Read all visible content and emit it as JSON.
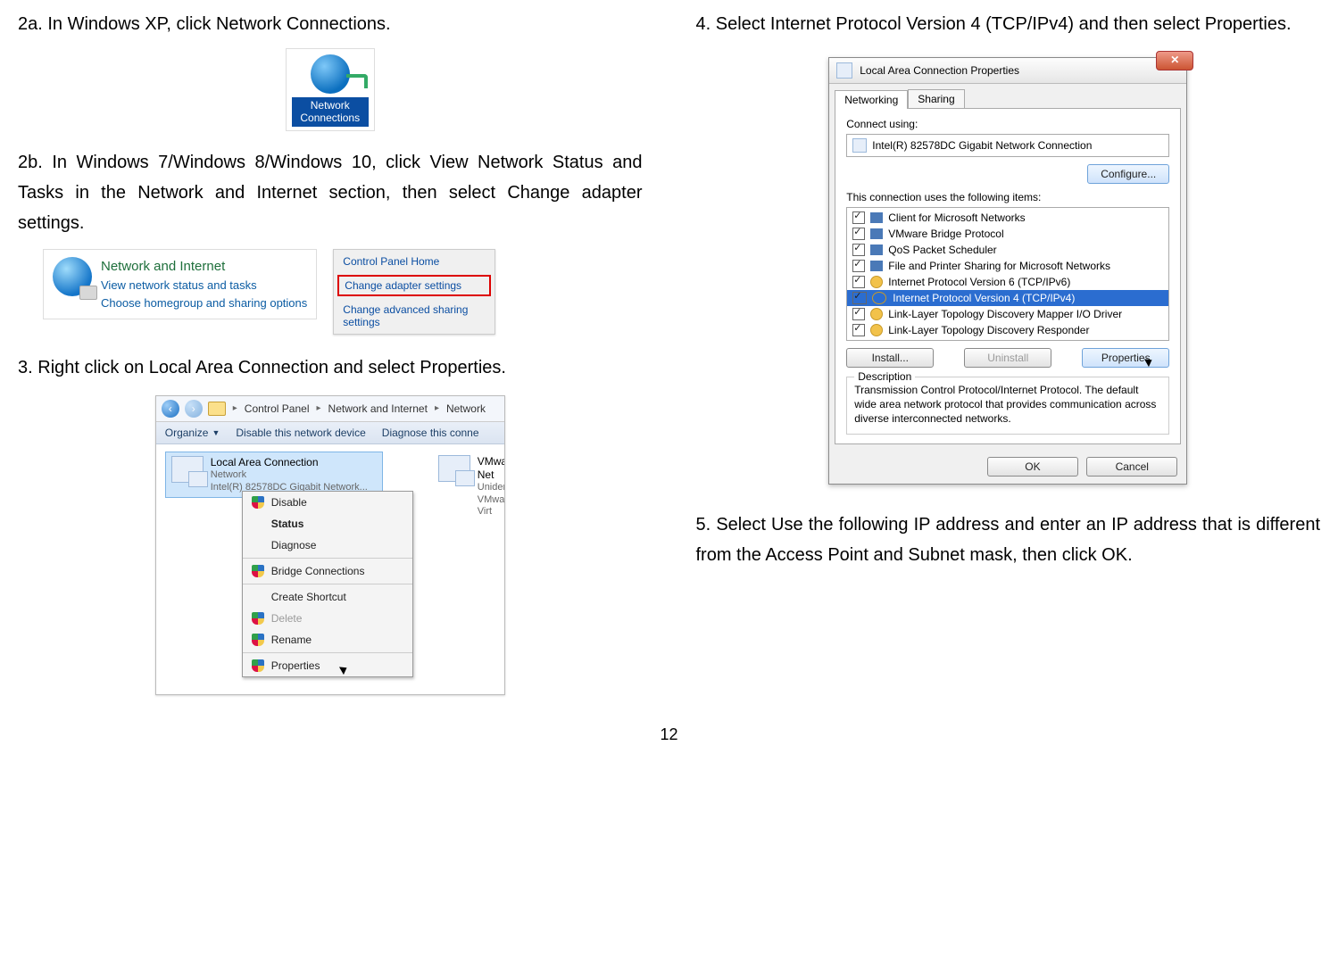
{
  "page_number": "12",
  "left": {
    "step2a": {
      "num": "2a.",
      "text": "In Windows XP, click Network Connections."
    },
    "xp_icon_label": "Network Connections",
    "step2b": {
      "num": "2b.",
      "text": "In Windows 7/Windows 8/Windows 10, click View Network Status and Tasks in the Network and Internet section, then select Change adapter settings."
    },
    "ni_title": "Network and Internet",
    "ni_links": [
      "View network status and tasks",
      "Choose homegroup and sharing options"
    ],
    "cph": {
      "title": "Control Panel Home",
      "items": [
        "Change adapter settings",
        "Change advanced sharing settings"
      ]
    },
    "step3": {
      "num": "3.",
      "text": "Right click on Local Area Connection and select Properties."
    },
    "fig3": {
      "breadcrumb": [
        "Control Panel",
        "Network and Internet",
        "Network"
      ],
      "toolbar": [
        "Organize",
        "Disable this network device",
        "Diagnose this conne"
      ],
      "lac": {
        "name": "Local Area Connection",
        "net": "Network",
        "adapter": "Intel(R) 82578DC Gigabit Network..."
      },
      "vm": {
        "name": "VMware Net",
        "net": "Unidentified",
        "adapter": "VMware Virt"
      },
      "ctx": [
        "Disable",
        "Status",
        "Diagnose",
        "Bridge Connections",
        "Create Shortcut",
        "Delete",
        "Rename",
        "Properties"
      ]
    }
  },
  "right": {
    "step4": {
      "num": "4.",
      "text": "Select Internet Protocol Version 4 (TCP/IPv4) and then select Properties."
    },
    "fig4": {
      "title": "Local Area Connection Properties",
      "close": "✕",
      "tabs": [
        "Networking",
        "Sharing"
      ],
      "connect_using_label": "Connect using:",
      "adapter": "Intel(R) 82578DC Gigabit Network Connection",
      "configure": "Configure...",
      "items_label": "This connection uses the following items:",
      "items": [
        "Client for Microsoft Networks",
        "VMware Bridge Protocol",
        "QoS Packet Scheduler",
        "File and Printer Sharing for Microsoft Networks",
        "Internet Protocol Version 6 (TCP/IPv6)",
        "Internet Protocol Version 4 (TCP/IPv4)",
        "Link-Layer Topology Discovery Mapper I/O Driver",
        "Link-Layer Topology Discovery Responder"
      ],
      "buttons": [
        "Install...",
        "Uninstall",
        "Properties"
      ],
      "desc_label": "Description",
      "desc": "Transmission Control Protocol/Internet Protocol. The default wide area network protocol that provides communication across diverse interconnected networks.",
      "ok": "OK",
      "cancel": "Cancel"
    },
    "step5": {
      "num": "5.",
      "text": "Select Use the following IP address and enter an IP address that is different from the Access Point and Subnet mask, then click OK."
    }
  }
}
